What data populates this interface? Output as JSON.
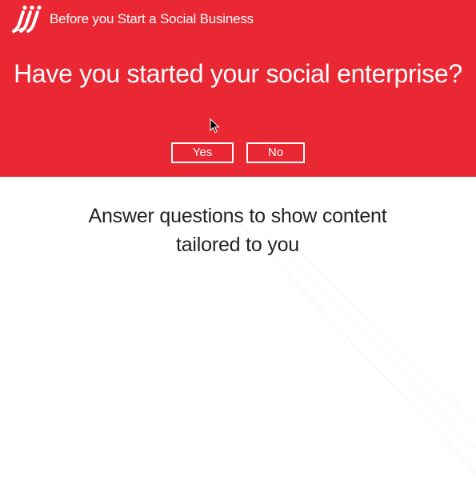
{
  "header": {
    "brand_title": "Before you Start a Social Business",
    "logo": "brand-logo-icon",
    "background_color": "#ea2834"
  },
  "question": {
    "text": "Have you started your social enterprise?",
    "options": [
      {
        "label": "Yes"
      },
      {
        "label": "No"
      }
    ]
  },
  "content": {
    "prompt_line1": "Answer questions to show content",
    "prompt_line2": "tailored to you"
  }
}
